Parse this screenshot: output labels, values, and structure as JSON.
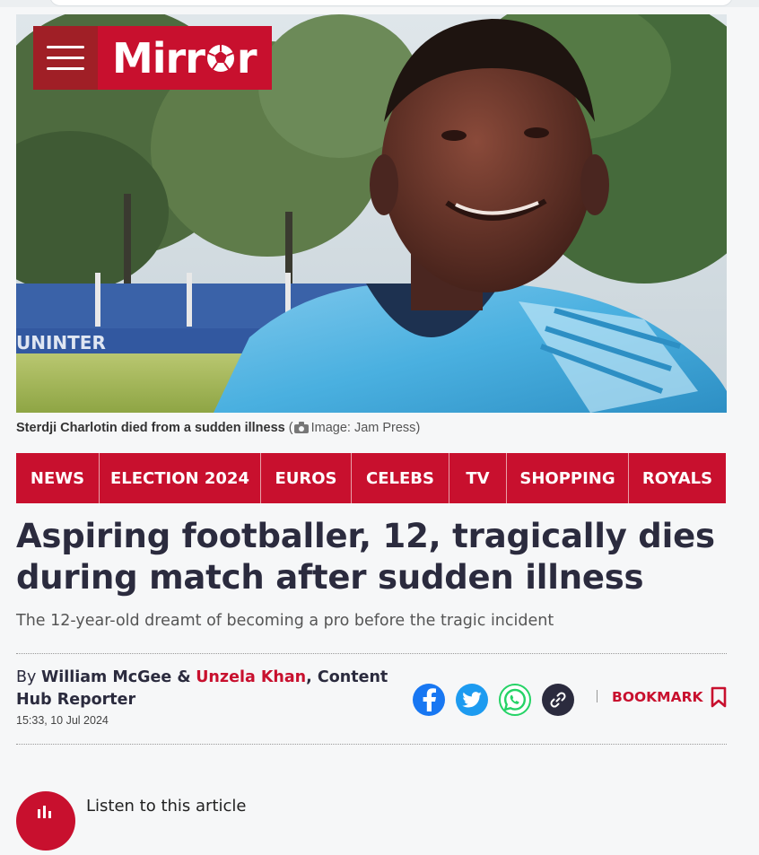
{
  "brand": {
    "logo_text": "Mirror",
    "accent": "#c8102e",
    "dark_accent": "#a01f26"
  },
  "hero": {
    "image_desc_icon": "photo-of-boy-in-blue-football-shirt",
    "wall_text": "UNINTER"
  },
  "caption": {
    "text": "Sterdji Charlotin died from a sudden illness",
    "credit": "Image: Jam Press"
  },
  "nav": {
    "items": [
      {
        "label": "NEWS"
      },
      {
        "label": "ELECTION 2024"
      },
      {
        "label": "EUROS"
      },
      {
        "label": "CELEBS"
      },
      {
        "label": "TV"
      },
      {
        "label": "SHOPPING"
      },
      {
        "label": "ROYALS"
      }
    ]
  },
  "article": {
    "headline_line1": "Aspiring footballer, 12, tragically dies",
    "headline_line2": "during match after sudden illness",
    "standfirst": "The 12-year-old dreamt of becoming a pro before the tragic incident",
    "by": "By",
    "author1": "William McGee &",
    "author2": "Unzela Khan",
    "role": ", Content Hub Reporter",
    "timestamp": "15:33, 10 Jul 2024"
  },
  "share": {
    "icons": [
      "facebook-icon",
      "twitter-icon",
      "whatsapp-icon",
      "link-icon"
    ],
    "bookmark_label": "BOOKMARK"
  },
  "listen": {
    "label": "Listen to this article"
  }
}
